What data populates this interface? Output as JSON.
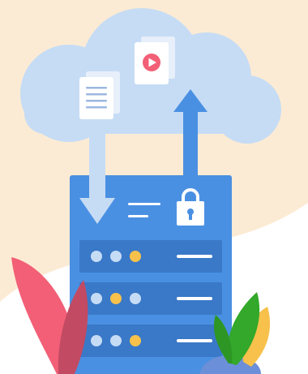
{
  "illustration": {
    "subject": "cloud-storage-server",
    "colors": {
      "background_blob": "#fcebd4",
      "cloud": "#c6dcf5",
      "server_body": "#4a90e2",
      "server_slot": "#3a78c8",
      "download_arrow": "#c6dcf5",
      "upload_arrow": "#4a90e2",
      "light_dot": "#c6dcf5",
      "accent_dot": "#f7c14b",
      "leaf_red": "#f25f76",
      "leaf_red_dark": "#c24a62",
      "leaf_green": "#33a82a",
      "leaf_yellow": "#f7c14b",
      "rock": "#6b8fd8",
      "document": "#ffffff",
      "play_button": "#f25f76"
    },
    "icons": {
      "document": "document-icon",
      "video_file": "video-file-icon",
      "lock": "padlock-icon",
      "download": "arrow-down-icon",
      "upload": "arrow-up-icon"
    },
    "server_rows": [
      {
        "dots": [
          "light",
          "light",
          "accent"
        ]
      },
      {
        "dots": [
          "light",
          "accent",
          "light"
        ]
      },
      {
        "dots": [
          "light",
          "light",
          "accent"
        ]
      }
    ]
  }
}
